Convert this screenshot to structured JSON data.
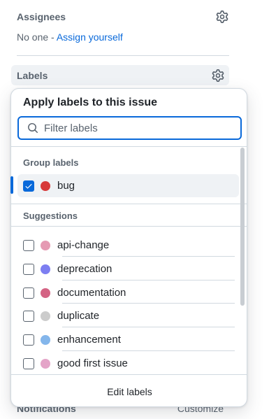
{
  "assignees": {
    "title": "Assignees",
    "none_text": "No one - ",
    "assign_link": "Assign yourself"
  },
  "labels": {
    "title": "Labels"
  },
  "notifications": {
    "title": "Notifications",
    "action": "Customize"
  },
  "popover": {
    "title": "Apply labels to this issue",
    "filter_placeholder": "Filter labels",
    "group_section": "Group labels",
    "suggestions_section": "Suggestions",
    "edit_labels": "Edit labels",
    "group_items": [
      {
        "name": "bug",
        "color": "#d73a3a",
        "checked": true
      }
    ],
    "suggestion_items": [
      {
        "name": "api-change",
        "color": "#e59ab3",
        "checked": false
      },
      {
        "name": "deprecation",
        "color": "#7d7ef1",
        "checked": false
      },
      {
        "name": "documentation",
        "color": "#d46384",
        "checked": false
      },
      {
        "name": "duplicate",
        "color": "#cccccc",
        "checked": false
      },
      {
        "name": "enhancement",
        "color": "#84b6eb",
        "checked": false
      },
      {
        "name": "good first issue",
        "color": "#e4a4c8",
        "checked": false
      }
    ]
  },
  "colors": {
    "accent": "#0969da",
    "muted_text": "#59636e",
    "border": "#d1d9e0"
  }
}
